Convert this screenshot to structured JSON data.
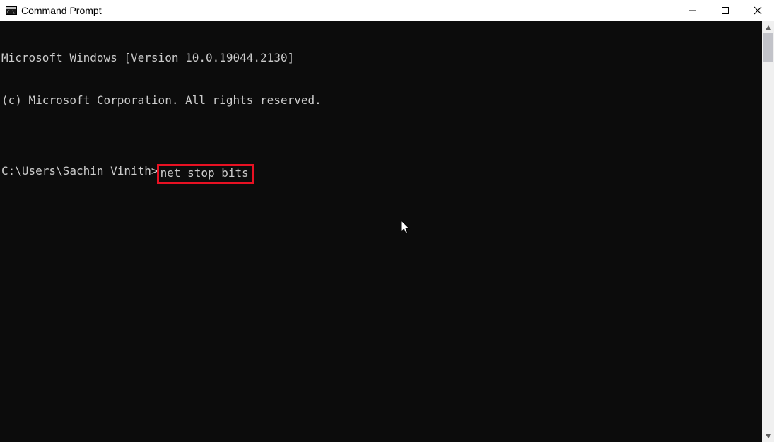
{
  "window": {
    "title": "Command Prompt"
  },
  "terminal": {
    "line1": "Microsoft Windows [Version 10.0.19044.2130]",
    "line2": "(c) Microsoft Corporation. All rights reserved.",
    "blank": "",
    "prompt": "C:\\Users\\Sachin Vinith>",
    "command": "net stop bits"
  }
}
